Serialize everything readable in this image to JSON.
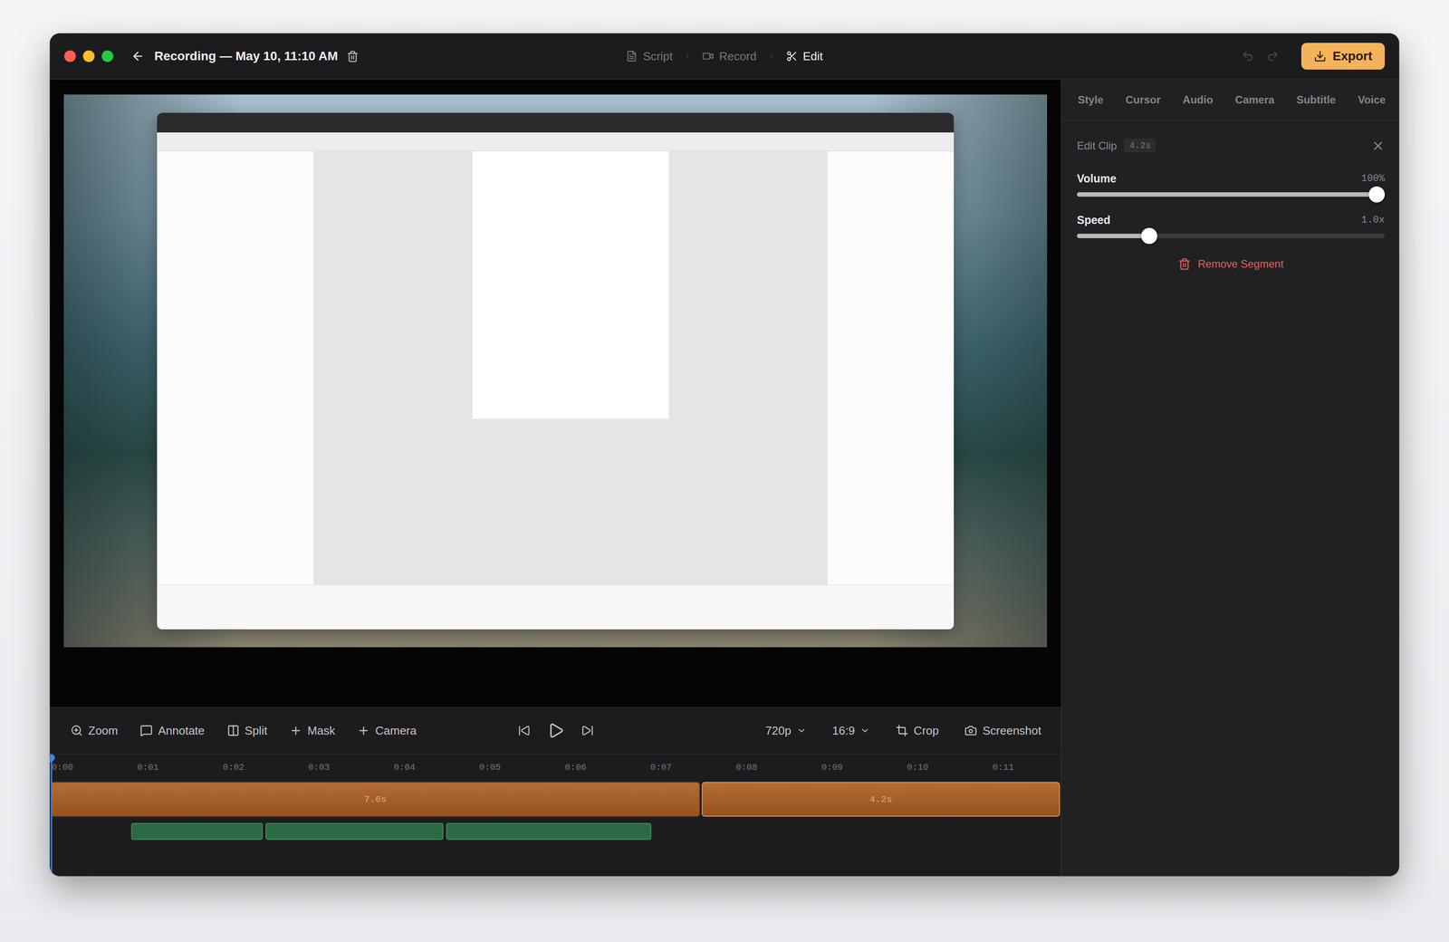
{
  "window": {
    "title": "Recording — May 10, 11:10 AM"
  },
  "history": {
    "undo_enabled": false,
    "redo_enabled": false
  },
  "steps": [
    {
      "label": "Script",
      "selected": false
    },
    {
      "label": "Record",
      "selected": false
    },
    {
      "label": "Edit",
      "selected": true
    }
  ],
  "export_button": {
    "label": "Export"
  },
  "toolbar": {
    "tools": [
      "Zoom",
      "Annotate",
      "Split",
      "Mask",
      "Camera"
    ],
    "resolution": "720p",
    "aspect_ratio": "16:9",
    "actions": [
      "Crop",
      "Screenshot"
    ]
  },
  "timeline": {
    "ticks": [
      "0:00",
      "0:01",
      "0:02",
      "0:03",
      "0:04",
      "0:05",
      "0:06",
      "0:07",
      "0:08",
      "0:09",
      "0:10",
      "0:11"
    ],
    "playhead": 0,
    "clips": [
      {
        "label": "7.6s",
        "duration": 7.6,
        "selected": false
      },
      {
        "label": "4.2s",
        "duration": 4.2,
        "selected": true
      }
    ],
    "audio_segments": [
      {
        "start": 0.94,
        "end": 2.49
      },
      {
        "start": 2.51,
        "end": 4.6
      },
      {
        "start": 4.62,
        "end": 7.03
      }
    ]
  },
  "panel": {
    "tabs": [
      {
        "label": "Style",
        "selected": false
      },
      {
        "label": "Cursor",
        "selected": false
      },
      {
        "label": "Audio",
        "selected": false
      },
      {
        "label": "Camera",
        "selected": false
      },
      {
        "label": "Subtitle",
        "selected": false
      },
      {
        "label": "Voice",
        "selected": false
      }
    ],
    "edit_clip": {
      "title": "Edit Clip",
      "badge": "4.2s",
      "sliders": [
        {
          "label": "Volume",
          "reading": "100%",
          "level": 1
        },
        {
          "label": "Speed",
          "reading": "1.0x",
          "level": 0.22
        }
      ],
      "remove_label": "Remove Segment"
    }
  }
}
